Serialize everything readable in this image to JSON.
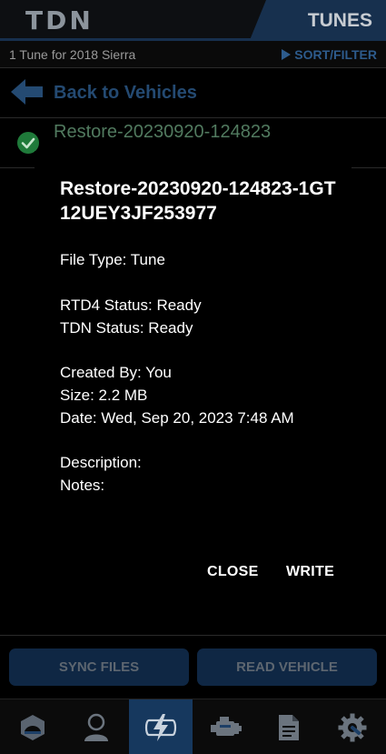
{
  "header": {
    "logo": "TDN",
    "active_tab": "TUNES"
  },
  "subbar": {
    "count_text": "1 Tune for 2018 Sierra",
    "sort_label": "SORT/FILTER"
  },
  "back": {
    "label": "Back to Vehicles"
  },
  "file_row": {
    "name": "Restore-20230920-124823",
    "status_icon": "check-circle-icon"
  },
  "modal": {
    "title": "Restore-20230920-124823-1GT12UEY3JF253977",
    "file_type": "File Type: Tune",
    "rtd4_status": "RTD4 Status: Ready",
    "tdn_status": "TDN Status: Ready",
    "created_by": "Created By: You",
    "size": "Size: 2.2 MB",
    "date": "Date: Wed, Sep 20, 2023 7:48 AM",
    "description": "Description:",
    "notes": "Notes:",
    "close_label": "CLOSE",
    "write_label": "WRITE"
  },
  "actions": {
    "sync_label": "SYNC FILES",
    "read_label": "READ VEHICLE"
  },
  "nav": {
    "items": [
      {
        "icon": "vehicle-icon"
      },
      {
        "icon": "user-icon"
      },
      {
        "icon": "tune-bolt-icon",
        "active": true
      },
      {
        "icon": "engine-icon"
      },
      {
        "icon": "document-icon"
      },
      {
        "icon": "settings-icon"
      }
    ]
  },
  "colors": {
    "accent": "#16385e",
    "button_bg": "#0f2744",
    "back_text": "#244a72",
    "success": "#1f7a3a"
  }
}
